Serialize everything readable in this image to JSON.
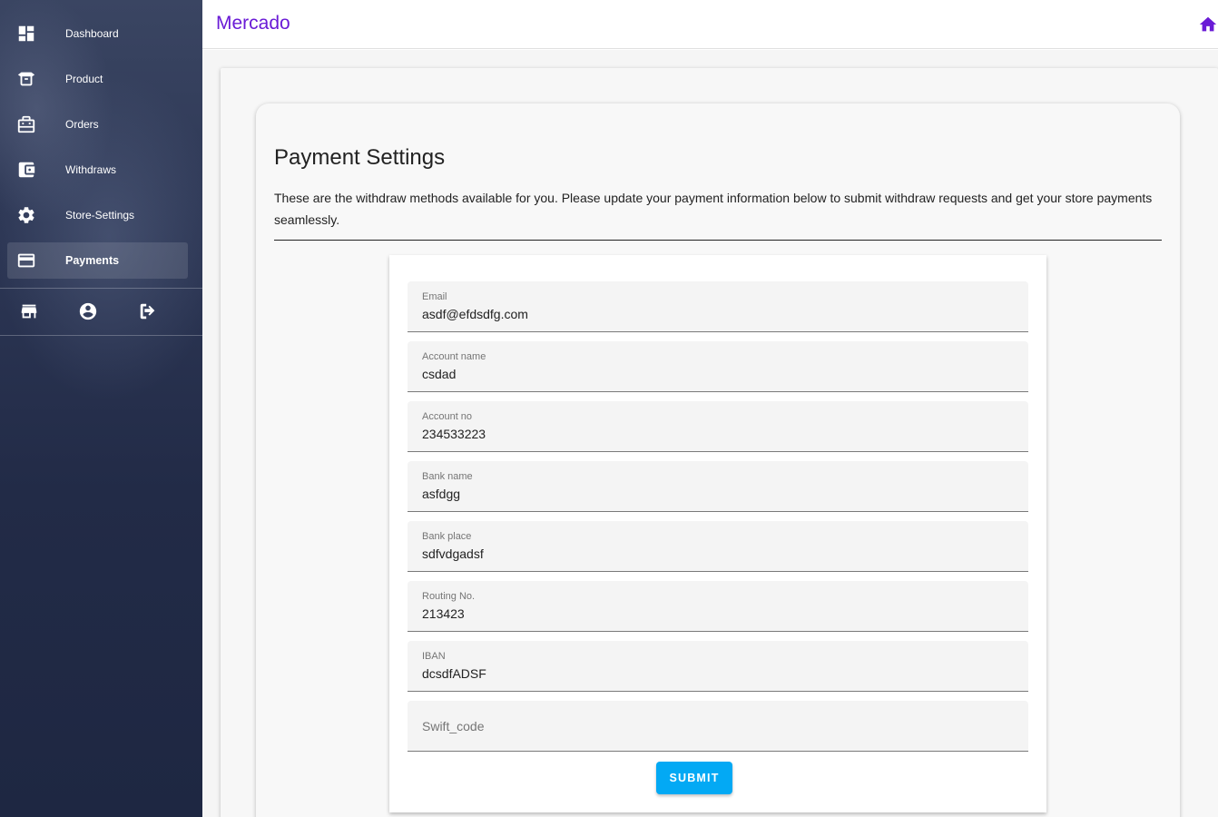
{
  "app": {
    "brand": "Mercado"
  },
  "sidebar": {
    "items": [
      {
        "label": "Dashboard",
        "icon": "dashboard-icon"
      },
      {
        "label": "Product",
        "icon": "box-icon"
      },
      {
        "label": "Orders",
        "icon": "orders-icon"
      },
      {
        "label": "Withdraws",
        "icon": "wallet-icon"
      },
      {
        "label": "Store-Settings",
        "icon": "gear-icon"
      },
      {
        "label": "Payments",
        "icon": "credit-card-icon",
        "active": true
      }
    ],
    "actions": [
      {
        "icon": "store-icon"
      },
      {
        "icon": "account-icon"
      },
      {
        "icon": "logout-icon"
      }
    ]
  },
  "page": {
    "title": "Payment Settings",
    "description": "These are the withdraw methods available for you. Please update your payment information below to submit withdraw requests and get your store payments seamlessly."
  },
  "form": {
    "fields": [
      {
        "label": "Email",
        "value": "asdf@efdsdfg.com"
      },
      {
        "label": "Account name",
        "value": "csdad"
      },
      {
        "label": "Account no",
        "value": "234533223"
      },
      {
        "label": "Bank name",
        "value": "asfdgg"
      },
      {
        "label": "Bank place",
        "value": "sdfvdgadsf"
      },
      {
        "label": "Routing No.",
        "value": "213423"
      },
      {
        "label": "IBAN",
        "value": "dcsdfADSF"
      }
    ],
    "swift_placeholder": "Swift_code",
    "submit_label": "SUBMIT"
  },
  "colors": {
    "brand": "#6a1bd6",
    "button": "#03a9f4",
    "sidebar": "#222b47"
  }
}
